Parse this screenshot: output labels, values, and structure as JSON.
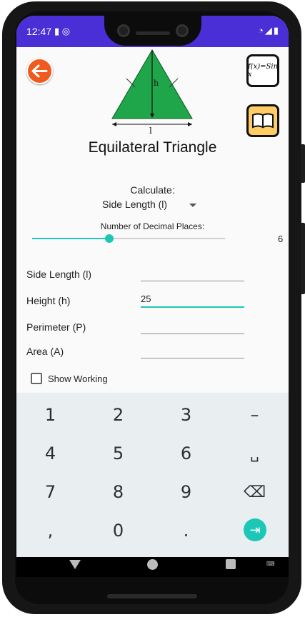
{
  "status_bar": {
    "time": "12:47",
    "left_icons": [
      "sd-card-icon",
      "sync-icon"
    ],
    "right_icons": [
      "wifi-icon",
      "signal-icon",
      "battery-icon"
    ]
  },
  "header": {
    "back_icon": "back-arrow-icon",
    "formula_button_text": "f(x)=Sin x",
    "help_icon": "book-icon",
    "diagram_labels": {
      "height": "h",
      "side": "l"
    },
    "title": "Equilateral Triangle"
  },
  "calculate": {
    "label": "Calculate:",
    "selected": "Side Length (l)"
  },
  "decimal_places": {
    "label": "Number of Decimal Places:",
    "value": "6",
    "slider_fraction": 0.4
  },
  "fields": [
    {
      "label": "Side Length (l)",
      "value": ""
    },
    {
      "label": "Height (h)",
      "value": "25"
    },
    {
      "label": "Perimeter (P)",
      "value": ""
    },
    {
      "label": "Area (A)",
      "value": ""
    }
  ],
  "show_working": {
    "label": "Show Working",
    "checked": false
  },
  "keyboard": {
    "rows": [
      [
        "1",
        "2",
        "3",
        "–"
      ],
      [
        "4",
        "5",
        "6",
        "␣"
      ],
      [
        "7",
        "8",
        "9",
        "⌫"
      ],
      [
        ",",
        "0",
        ".",
        "⇥"
      ]
    ]
  },
  "colors": {
    "status_bar": "#4a2fd6",
    "accent": "#1cc7b6",
    "triangle": "#1fa64a",
    "back_button": "#f05a1e",
    "tab_indicator": "#f2b318"
  }
}
